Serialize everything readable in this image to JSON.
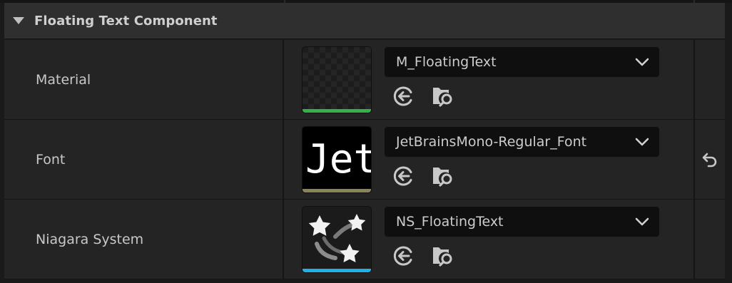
{
  "category": {
    "title": "Floating Text Component",
    "arrow_icon": "caret-down-icon"
  },
  "properties": [
    {
      "label": "Material",
      "asset_name": "M_FloatingText",
      "thumbnail": "checker-material",
      "bar_color": "#2fb34a",
      "has_reset": false
    },
    {
      "label": "Font",
      "asset_name": "JetBrainsMono-Regular_Font",
      "thumbnail": "font-preview",
      "thumbnail_text": "Jet",
      "bar_color": "#8a8558",
      "has_reset": true
    },
    {
      "label": "Niagara System",
      "asset_name": "NS_FloatingText",
      "thumbnail": "niagara-stars",
      "bar_color": "#1fb0e6",
      "has_reset": false
    }
  ],
  "icons": {
    "use_selected": "arrow-left-circle-icon",
    "browse": "folder-search-icon",
    "dropdown": "chevron-down-icon",
    "reset": "reset-arrow-icon"
  },
  "colors": {
    "background": "#1a1a1a",
    "row": "#242424",
    "category": "#2f2f2f",
    "combo": "#0f0f0f",
    "text": "#c8c8c8"
  }
}
